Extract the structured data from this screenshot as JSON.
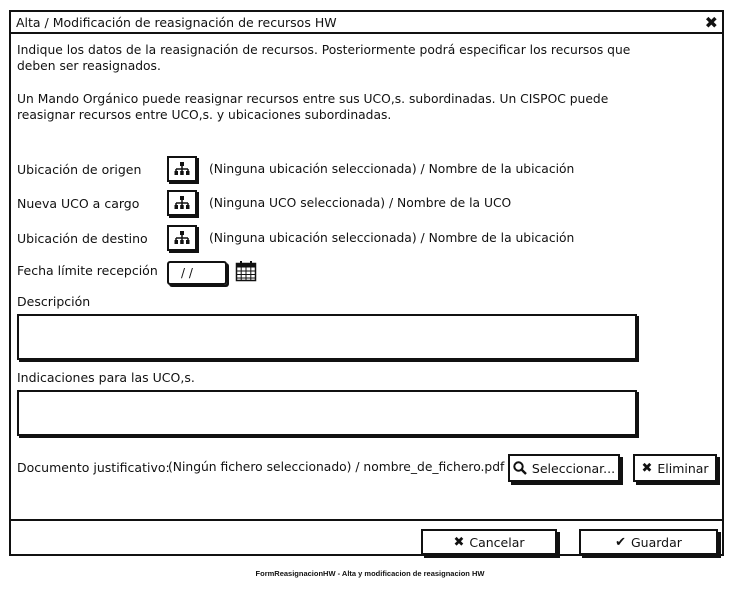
{
  "window": {
    "title": "Alta / Modificación de reasignación de recursos HW",
    "close_glyph": "✖"
  },
  "intro": {
    "paragraph1_line1": "Indique los datos de la reasignación de recursos. Posteriormente podrá especificar los recursos que",
    "paragraph1_line2": "deben ser reasignados.",
    "paragraph2_line1": "Un Mando Orgánico puede reasignar recursos entre sus UCO,s. subordinadas. Un CISPOC puede",
    "paragraph2_line2": "reasignar recursos entre UCO,s. y ubicaciones subordinadas."
  },
  "fields": {
    "origen": {
      "label": "Ubicación de origen",
      "value": "(Ninguna ubicación seleccionada) / Nombre de la ubicación",
      "icon": "org-tree-icon"
    },
    "uco": {
      "label": "Nueva UCO a cargo",
      "value": "(Ninguna UCO seleccionada) / Nombre de la UCO",
      "icon": "org-tree-icon"
    },
    "destino": {
      "label": "Ubicación de destino",
      "value": "(Ninguna ubicación seleccionada) / Nombre de la ubicación",
      "icon": "org-tree-icon"
    },
    "fecha": {
      "label": "Fecha límite recepción",
      "value": " / /",
      "icon": "calendar-icon"
    },
    "descripcion": {
      "label": "Descripción",
      "value": ""
    },
    "indicaciones": {
      "label": "Indicaciones para las UCO,s.",
      "value": ""
    },
    "documento": {
      "label": "Documento justificativo:",
      "value": "(Ningún fichero seleccionado) / nombre_de_fichero.pdf",
      "select_label": "Seleccionar...",
      "delete_label": "Eliminar"
    }
  },
  "footer": {
    "cancel_label": "Cancelar",
    "save_label": "Guardar"
  },
  "caption": "FormReasignacionHW - Alta y modificacion de reasignacion HW"
}
